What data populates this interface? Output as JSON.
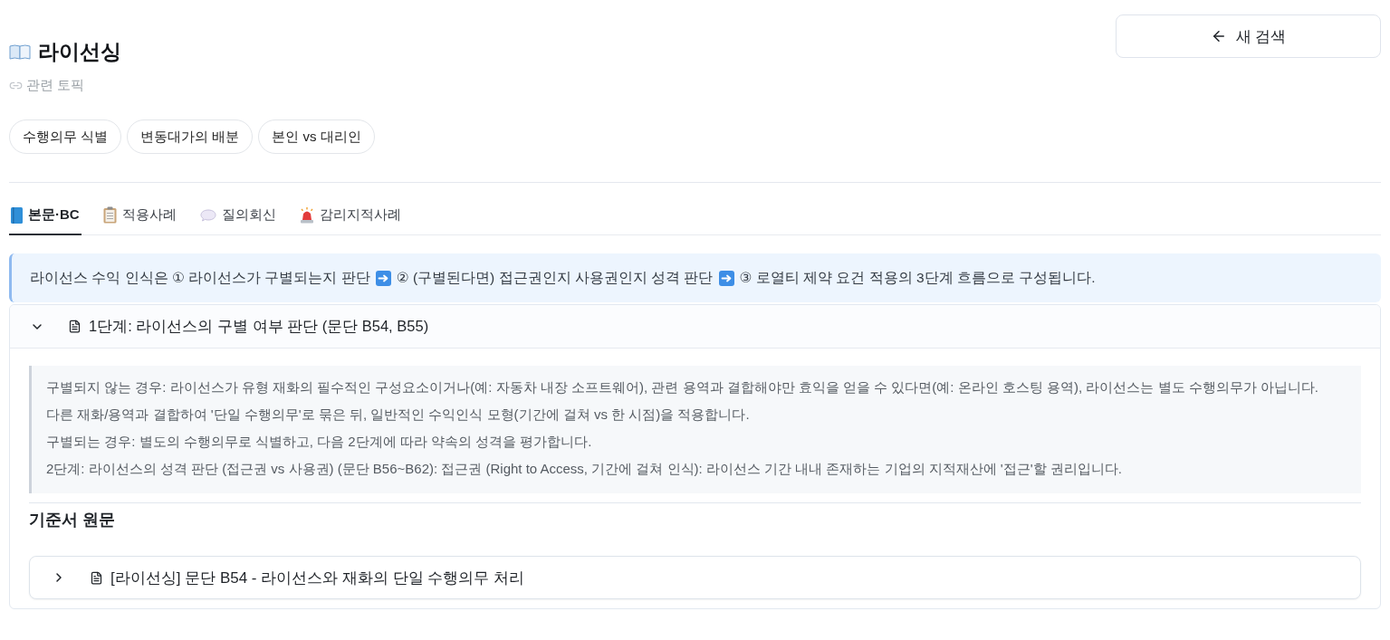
{
  "header": {
    "title": "라이선싱",
    "related_label": "관련 토픽",
    "new_search_button": "새 검색"
  },
  "topics": [
    "수행의무 식별",
    "변동대가의 배분",
    "본인 vs 대리인"
  ],
  "tabs": [
    {
      "label": "본문·BC",
      "kind": "book",
      "selected": true
    },
    {
      "label": "적용사례",
      "kind": "clipboard",
      "selected": false
    },
    {
      "label": "질의회신",
      "kind": "speech",
      "selected": false
    },
    {
      "label": "감리지적사례",
      "kind": "siren",
      "selected": false
    }
  ],
  "summary": {
    "segments": [
      "라이선스 수익 인식은 ① 라이선스가 구별되는지 판단",
      "② (구별된다면) 접근권인지 사용권인지 성격 판단",
      "③ 로열티 제약 요건 적용의 3단계 흐름으로 구성됩니다."
    ]
  },
  "sections": [
    {
      "title": "1단계: 라이선스의 구별 여부 판단 (문단 B54, B55)",
      "expanded": true,
      "quote": [
        "구별되지 않는 경우: 라이선스가 유형 재화의 필수적인 구성요소이거나(예: 자동차 내장 소프트웨어), 관련 용역과 결합해야만 효익을 얻을 수 있다면(예: 온라인 호스팅 용역), 라이선스는 별도 수행의무가 아닙니다.",
        "다른 재화/용역과 결합하여 '단일 수행의무'로 묶은 뒤, 일반적인 수익인식 모형(기간에 걸쳐 vs 한 시점)을 적용합니다.",
        "구별되는 경우: 별도의 수행의무로 식별하고, 다음 2단계에 따라 약속의 성격을 평가합니다.",
        "2단계: 라이선스의 성격 판단 (접근권 vs 사용권) (문단 B56~B62): 접근권 (Right to Access, 기간에 걸쳐 인식): 라이선스 기간 내내 존재하는 기업의 지적재산에 '접근'할 권리입니다."
      ],
      "source_heading": "기준서 원문",
      "sources": [
        {
          "title": "[라이선싱] 문단 B54 - 라이선스와 재화의 단일 수행의무 처리",
          "expanded": false
        }
      ]
    }
  ]
}
